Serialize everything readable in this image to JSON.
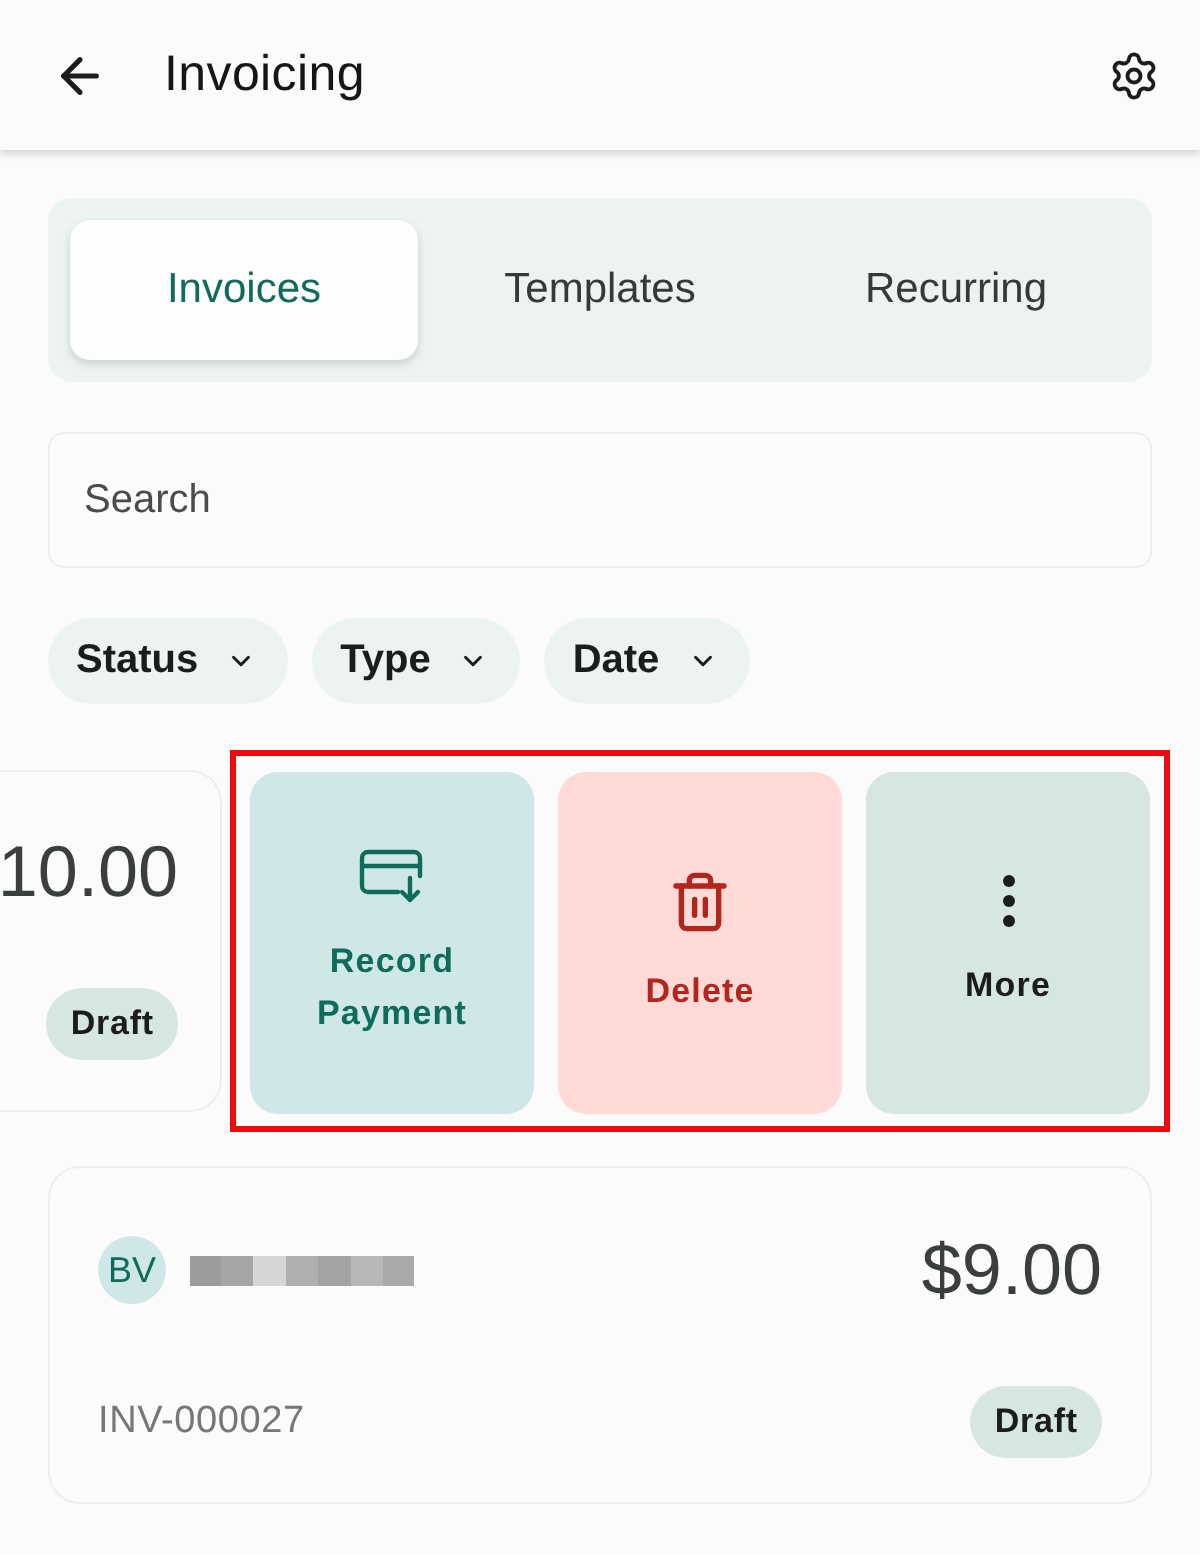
{
  "header": {
    "title": "Invoicing"
  },
  "tabs": [
    {
      "label": "Invoices",
      "selected": true
    },
    {
      "label": "Templates",
      "selected": false
    },
    {
      "label": "Recurring",
      "selected": false
    }
  ],
  "search": {
    "placeholder": "Search"
  },
  "filters": [
    {
      "label": "Status"
    },
    {
      "label": "Type"
    },
    {
      "label": "Date"
    }
  ],
  "invoices": [
    {
      "swiped": true,
      "amount": "10.00",
      "status": "Draft",
      "highlighted": true,
      "actions": [
        {
          "kind": "payment",
          "label": "Record Payment"
        },
        {
          "kind": "delete",
          "label": "Delete"
        },
        {
          "kind": "more",
          "label": "More"
        }
      ]
    },
    {
      "swiped": false,
      "avatar": "BV",
      "amount": "$9.00",
      "number": "INV-000027",
      "status": "Draft"
    }
  ]
}
